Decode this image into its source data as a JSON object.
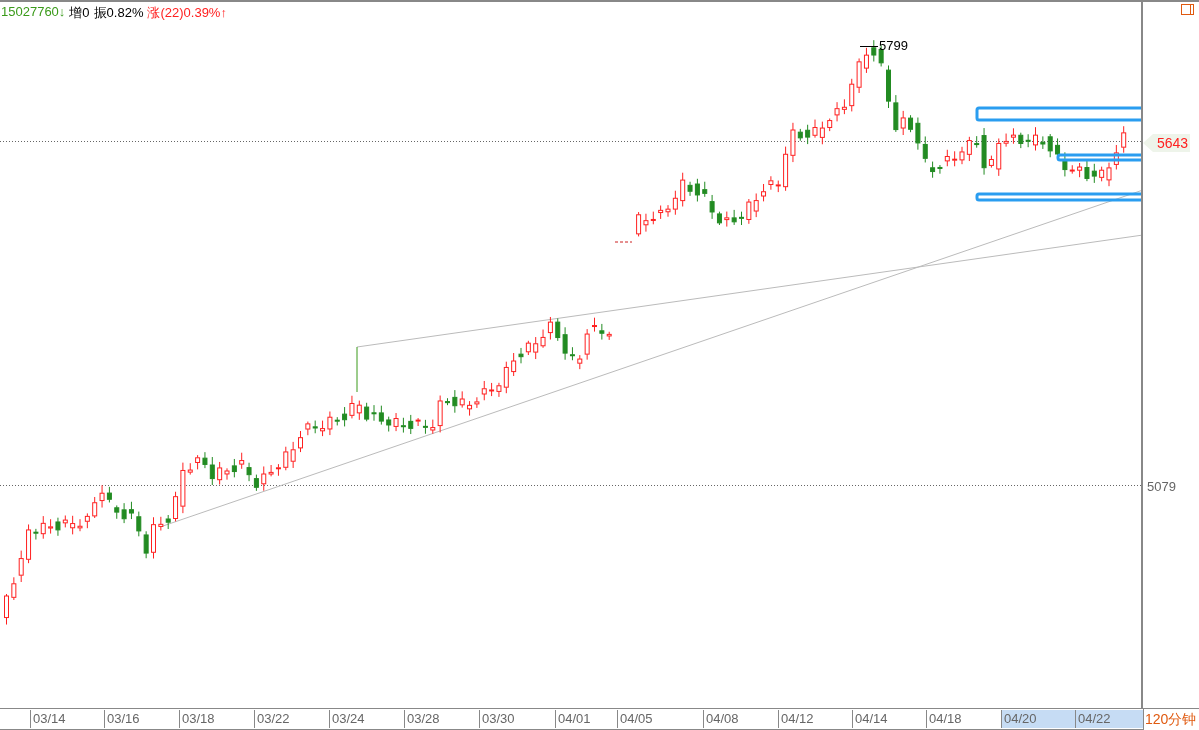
{
  "header": {
    "stats": [
      {
        "text": "15027760↓",
        "color": "#3a9a1a"
      },
      {
        "text": "增0",
        "color": "#000000"
      },
      {
        "text": "振0.82%",
        "color": "#000000"
      },
      {
        "text": "涨(22)0.39%↑",
        "color": "#ff2020"
      }
    ]
  },
  "chart": {
    "high_label": "5799",
    "price_axis": [
      {
        "label": "5643",
        "kind": "current"
      },
      {
        "label": "5079",
        "kind": "gridline"
      }
    ]
  },
  "time_axis": {
    "labels": [
      {
        "label": "03/14",
        "selected": false
      },
      {
        "label": "03/16",
        "selected": false
      },
      {
        "label": "03/18",
        "selected": false
      },
      {
        "label": "03/22",
        "selected": false
      },
      {
        "label": "03/24",
        "selected": false
      },
      {
        "label": "03/28",
        "selected": false
      },
      {
        "label": "03/30",
        "selected": false
      },
      {
        "label": "04/01",
        "selected": false
      },
      {
        "label": "04/05",
        "selected": false
      },
      {
        "label": "04/08",
        "selected": false
      },
      {
        "label": "04/12",
        "selected": false
      },
      {
        "label": "04/14",
        "selected": false
      },
      {
        "label": "04/18",
        "selected": false
      },
      {
        "label": "04/20",
        "selected": true
      },
      {
        "label": "04/22",
        "selected": true
      }
    ],
    "period": "120分钟"
  }
}
